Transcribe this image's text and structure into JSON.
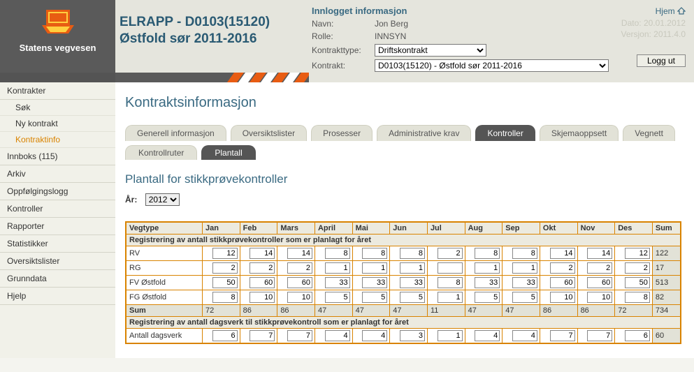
{
  "brand": {
    "org_name": "Statens vegvesen"
  },
  "header": {
    "app_title_line1": "ELRAPP - D0103(15120)",
    "app_title_line2": "Østfold sør 2011-2016",
    "info_title": "Innlogget informasjon",
    "name_label": "Navn:",
    "name_value": "Jon Berg",
    "role_label": "Rolle:",
    "role_value": "INNSYN",
    "contracttype_label": "Kontrakttype:",
    "contracttype_value": "Driftskontrakt",
    "contract_label": "Kontrakt:",
    "contract_value": "D0103(15120) - Østfold sør 2011-2016",
    "home_label": "Hjem",
    "date_label": "Dato: 20.01.2012",
    "version_label": "Versjon:   2011.4.0",
    "logout_label": "Logg ut"
  },
  "sidebar": {
    "items": [
      {
        "label": "Kontrakter"
      },
      {
        "label": "Søk",
        "sub": true
      },
      {
        "label": "Ny kontrakt",
        "sub": true
      },
      {
        "label": "Kontraktinfo",
        "sub": true,
        "selected": true
      },
      {
        "label": "Innboks (115)"
      },
      {
        "label": "Arkiv"
      },
      {
        "label": "Oppfølgingslogg"
      },
      {
        "label": "Kontroller"
      },
      {
        "label": "Rapporter"
      },
      {
        "label": "Statistikker"
      },
      {
        "label": "Oversiktslister"
      },
      {
        "label": "Grunndata"
      },
      {
        "label": "Hjelp"
      }
    ]
  },
  "page": {
    "title": "Kontraktsinformasjon",
    "tabs": [
      "Generell informasjon",
      "Oversiktslister",
      "Prosesser",
      "Administrative krav",
      "Kontroller",
      "Skjemaoppsett",
      "Vegnett"
    ],
    "active_tab": 4,
    "subtabs": [
      "Kontrollruter",
      "Plantall"
    ],
    "active_subtab": 1,
    "section_title": "Plantall for stikkprøvekontroller",
    "year_label": "År:",
    "year_value": "2012"
  },
  "table": {
    "section1_title": "Registrering av antall stikkprøvekontroller som er planlagt for året",
    "columns": [
      "Vegtype",
      "Jan",
      "Feb",
      "Mars",
      "April",
      "Mai",
      "Jun",
      "Jul",
      "Aug",
      "Sep",
      "Okt",
      "Nov",
      "Des",
      "Sum"
    ],
    "rows": [
      {
        "label": "RV",
        "vals": [
          12,
          14,
          14,
          8,
          8,
          8,
          2,
          8,
          8,
          14,
          14,
          12
        ],
        "sum": 122
      },
      {
        "label": "RG",
        "vals": [
          2,
          2,
          2,
          1,
          1,
          1,
          "",
          1,
          1,
          2,
          2,
          2
        ],
        "sum": 17
      },
      {
        "label": "FV Østfold",
        "vals": [
          50,
          60,
          60,
          33,
          33,
          33,
          8,
          33,
          33,
          60,
          60,
          50
        ],
        "sum": 513
      },
      {
        "label": "FG Østfold",
        "vals": [
          8,
          10,
          10,
          5,
          5,
          5,
          1,
          5,
          5,
          10,
          10,
          8
        ],
        "sum": 82
      }
    ],
    "sum_row": {
      "label": "Sum",
      "vals": [
        72,
        86,
        86,
        47,
        47,
        47,
        11,
        47,
        47,
        86,
        86,
        72
      ],
      "sum": 734
    },
    "section2_title": "Registrering av antall dagsverk til stikkprøvekontroll som er planlagt for året",
    "dagsverk_row": {
      "label": "Antall dagsverk",
      "vals": [
        6,
        7,
        7,
        4,
        4,
        3,
        1,
        4,
        4,
        7,
        7,
        6
      ],
      "sum": 60
    }
  }
}
